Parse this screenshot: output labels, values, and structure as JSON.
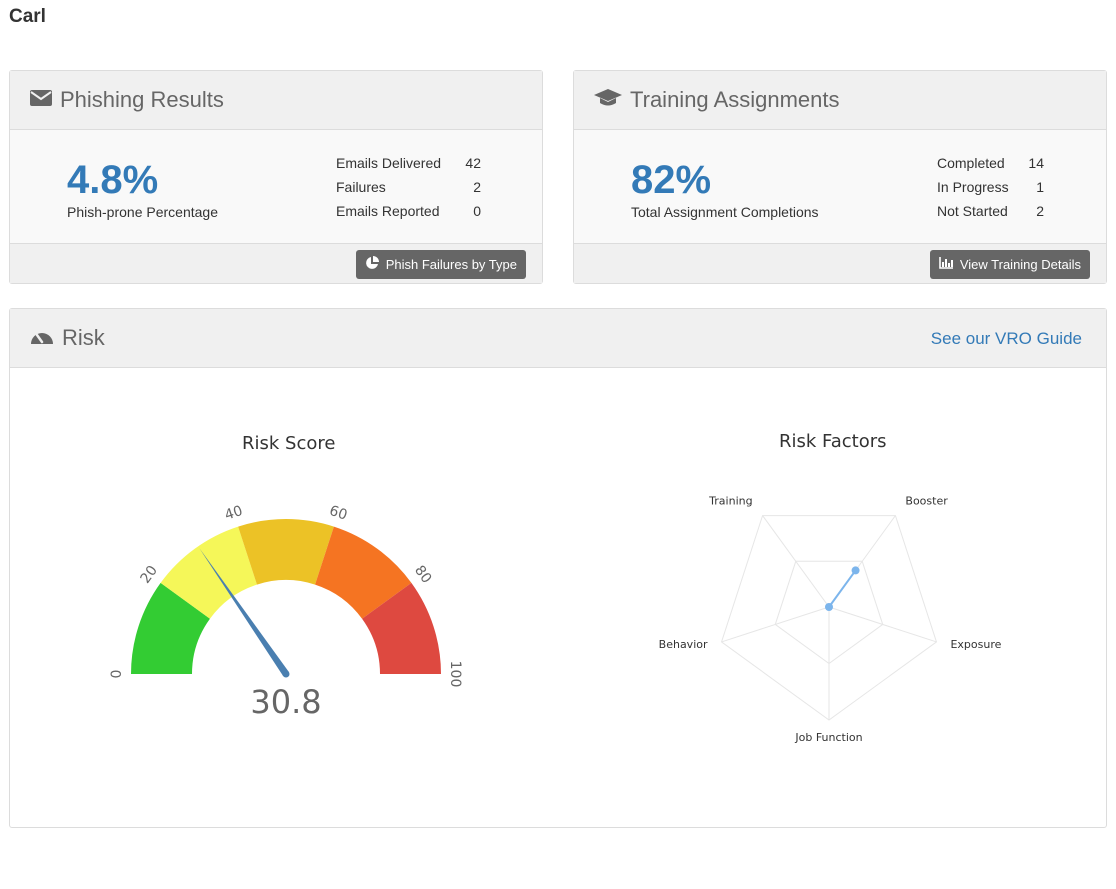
{
  "user": {
    "name": "Carl"
  },
  "phishing": {
    "title": "Phishing Results",
    "percentage": "4.8%",
    "percentage_label": "Phish-prone Percentage",
    "stats": [
      {
        "label": "Emails Delivered",
        "value": "42"
      },
      {
        "label": "Failures",
        "value": "2"
      },
      {
        "label": "Emails Reported",
        "value": "0"
      }
    ],
    "button_label": "Phish Failures by Type"
  },
  "training": {
    "title": "Training Assignments",
    "percentage": "82%",
    "percentage_label": "Total Assignment Completions",
    "stats": [
      {
        "label": "Completed",
        "value": "14"
      },
      {
        "label": "In Progress",
        "value": "1"
      },
      {
        "label": "Not Started",
        "value": "2"
      }
    ],
    "button_label": "View Training Details"
  },
  "risk": {
    "title": "Risk",
    "guide_link": "See our VRO Guide"
  },
  "chart_data": [
    {
      "type": "gauge",
      "title": "Risk Score",
      "value": 30.8,
      "value_label": "30.8",
      "min": 0,
      "max": 100,
      "tick_labels": [
        "0",
        "20",
        "40",
        "60",
        "80",
        "100"
      ],
      "bands": [
        {
          "from": 0,
          "to": 20,
          "color": "#33cc33"
        },
        {
          "from": 20,
          "to": 40,
          "color": "#f5f759"
        },
        {
          "from": 40,
          "to": 60,
          "color": "#ecc226"
        },
        {
          "from": 60,
          "to": 80,
          "color": "#f57422"
        },
        {
          "from": 80,
          "to": 100,
          "color": "#de4940"
        }
      ],
      "needle_color": "#4a7fb0"
    },
    {
      "type": "radar",
      "title": "Risk Factors",
      "axes": [
        "Training",
        "Booster",
        "Exposure",
        "Job Function",
        "Behavior"
      ],
      "values": [
        0,
        2,
        0,
        0,
        0
      ],
      "max": 5,
      "series_color": "#7cb5ec"
    }
  ]
}
